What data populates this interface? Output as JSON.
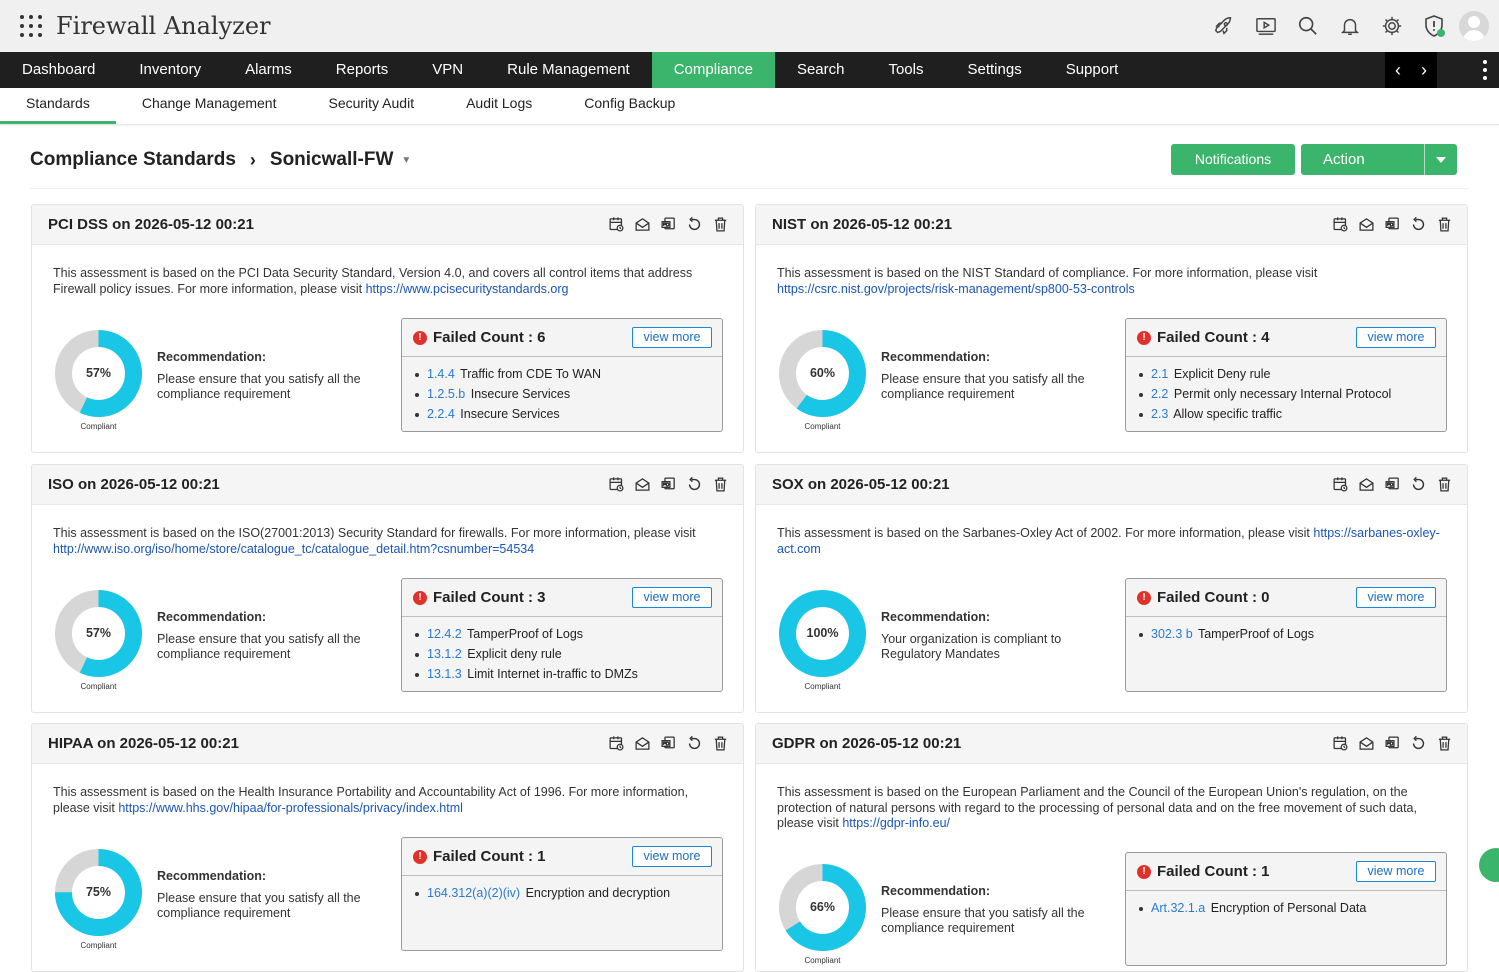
{
  "app": {
    "title": "Firewall Analyzer"
  },
  "main_nav": [
    {
      "label": "Dashboard"
    },
    {
      "label": "Inventory"
    },
    {
      "label": "Alarms"
    },
    {
      "label": "Reports"
    },
    {
      "label": "VPN"
    },
    {
      "label": "Rule Management"
    },
    {
      "label": "Compliance",
      "active": true
    },
    {
      "label": "Search"
    },
    {
      "label": "Tools"
    },
    {
      "label": "Settings"
    },
    {
      "label": "Support"
    }
  ],
  "sub_nav": [
    {
      "label": "Standards",
      "active": true
    },
    {
      "label": "Change Management"
    },
    {
      "label": "Security Audit"
    },
    {
      "label": "Audit Logs"
    },
    {
      "label": "Config Backup"
    }
  ],
  "top_icons": [
    "rocket-icon",
    "video-icon",
    "search-icon",
    "bell-icon",
    "gear-icon",
    "shield-icon",
    "user-avatar-icon"
  ],
  "page": {
    "breadcrumb_root": "Compliance Standards",
    "breadcrumb_device": "Sonicwall-FW",
    "notifications_label": "Notifications",
    "action_label": "Action"
  },
  "colors": {
    "accent": "#3bb56b",
    "donut_fill": "#19c6e6",
    "donut_rest": "#d6d6d6",
    "fail": "#e0322b",
    "link": "#1a55b8"
  },
  "cards": [
    {
      "title": "PCI DSS on 2026-05-12 00:21",
      "desc": "This assessment is based on the PCI Data Security Standard, Version 4.0, and covers all control items that address Firewall policy issues. For more information, please visit ",
      "link": "https://www.pcisecuritystandards.org",
      "percent": 57,
      "percent_label": "57%",
      "compliant_label": "Compliant",
      "rec_title": "Recommendation:",
      "rec_text": "Please ensure that you satisfy all the compliance requirement",
      "failed_label": "Failed Count : 6",
      "view_more": "view more",
      "items": [
        {
          "code": "1.4.4",
          "text": "Traffic from CDE To WAN"
        },
        {
          "code": "1.2.5.b",
          "text": "Insecure Services"
        },
        {
          "code": "2.2.4",
          "text": "Insecure Services"
        }
      ]
    },
    {
      "title": "NIST on 2026-05-12 00:21",
      "desc": "This assessment is based on the NIST Standard of compliance. For more information, please visit ",
      "link": "https://csrc.nist.gov/projects/risk-management/sp800-53-controls",
      "percent": 60,
      "percent_label": "60%",
      "compliant_label": "Compliant",
      "rec_title": "Recommendation:",
      "rec_text": "Please ensure that you satisfy all the compliance requirement",
      "failed_label": "Failed Count : 4",
      "view_more": "view more",
      "items": [
        {
          "code": "2.1",
          "text": "Explicit Deny rule"
        },
        {
          "code": "2.2",
          "text": "Permit only necessary Internal Protocol"
        },
        {
          "code": "2.3",
          "text": "Allow specific traffic"
        }
      ]
    },
    {
      "title": "ISO on 2026-05-12 00:21",
      "desc": "This assessment is based on the ISO(27001:2013) Security Standard for firewalls. For more information, please visit ",
      "link": "http://www.iso.org/iso/home/store/catalogue_tc/catalogue_detail.htm?csnumber=54534",
      "percent": 57,
      "percent_label": "57%",
      "compliant_label": "Compliant",
      "rec_title": "Recommendation:",
      "rec_text": "Please ensure that you satisfy all the compliance requirement",
      "failed_label": "Failed Count : 3",
      "view_more": "view more",
      "items": [
        {
          "code": "12.4.2",
          "text": "TamperProof of Logs"
        },
        {
          "code": "13.1.2",
          "text": "Explicit deny rule"
        },
        {
          "code": "13.1.3",
          "text": "Limit Internet in-traffic to DMZs"
        }
      ]
    },
    {
      "title": "SOX on 2026-05-12 00:21",
      "desc": "This assessment is based on the Sarbanes-Oxley Act of 2002. For more information, please visit ",
      "link": "https://sarbanes-oxley-act.com",
      "percent": 100,
      "percent_label": "100%",
      "compliant_label": "Compliant",
      "rec_title": "Recommendation:",
      "rec_text": "Your organization is compliant to Regulatory Mandates",
      "failed_label": "Failed Count : 0",
      "view_more": "view more",
      "items": [
        {
          "code": "302.3 b",
          "text": "TamperProof of Logs"
        }
      ]
    },
    {
      "title": "HIPAA on 2026-05-12 00:21",
      "desc": "This assessment is based on the Health Insurance Portability and Accountability Act of 1996. For more information, please visit ",
      "link": "https://www.hhs.gov/hipaa/for-professionals/privacy/index.html",
      "percent": 75,
      "percent_label": "75%",
      "compliant_label": "Compliant",
      "rec_title": "Recommendation:",
      "rec_text": "Please ensure that you satisfy all the compliance requirement",
      "failed_label": "Failed Count : 1",
      "view_more": "view more",
      "items": [
        {
          "code": "164.312(a)(2)(iv)",
          "text": "Encryption and decryption"
        }
      ]
    },
    {
      "title": "GDPR on 2026-05-12 00:21",
      "desc": "This assessment is based on the European Parliament and the Council of the European Union's regulation, on the protection of natural persons with regard to the processing of personal data and on the free movement of such data, please visit ",
      "link": "https://gdpr-info.eu/",
      "percent": 66,
      "percent_label": "66%",
      "compliant_label": "Compliant",
      "rec_title": "Recommendation:",
      "rec_text": "Please ensure that you satisfy all the compliance requirement",
      "failed_label": "Failed Count : 1",
      "view_more": "view more",
      "items": [
        {
          "code": "Art.32.1.a",
          "text": "Encryption of Personal Data"
        }
      ]
    }
  ]
}
